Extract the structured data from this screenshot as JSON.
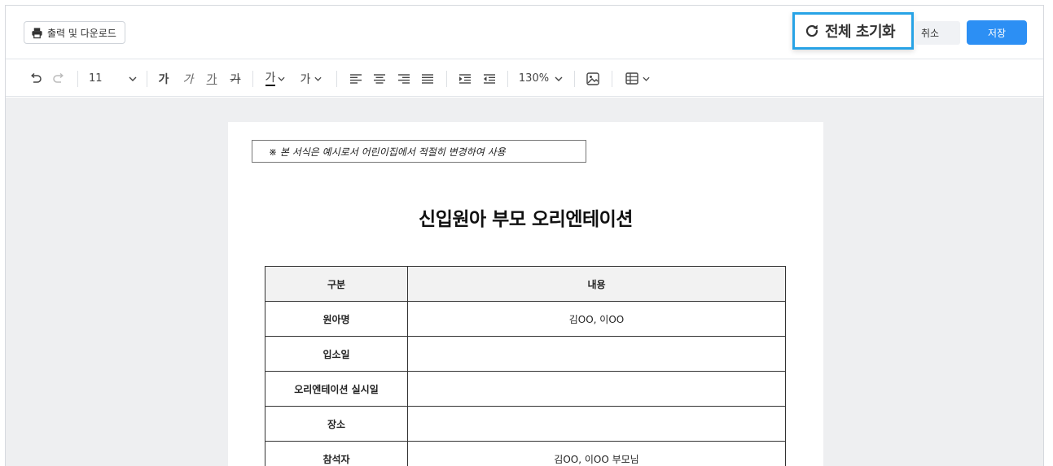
{
  "header": {
    "print_label": "출력 및 다운로드",
    "reset_label": "전체 초기화",
    "cancel_label": "취소",
    "save_label": "저장"
  },
  "toolbar": {
    "font_size": "11",
    "bold_glyph": "가",
    "italic_glyph": "가",
    "underline_glyph": "가",
    "strike_glyph": "가",
    "font_color_glyph": "가",
    "highlight_glyph": "가",
    "zoom": "130%"
  },
  "document": {
    "notice": "※ 본 서식은 예시로서 어린이집에서 적절히 변경하여 사용",
    "title": "신입원아 부모 오리엔테이션",
    "table": {
      "headers": [
        "구분",
        "내용"
      ],
      "rows": [
        {
          "label": "원아명",
          "value": "김OO, 이OO"
        },
        {
          "label": "입소일",
          "value": ""
        },
        {
          "label": "오리엔테이션 실시일",
          "value": ""
        },
        {
          "label": "장소",
          "value": ""
        },
        {
          "label": "참석자",
          "value": "김OO, 이OO 부모님"
        }
      ]
    }
  },
  "colors": {
    "accent": "#2c8ff4",
    "highlight_border": "#27a3e6",
    "canvas_bg": "#eeeff1"
  }
}
